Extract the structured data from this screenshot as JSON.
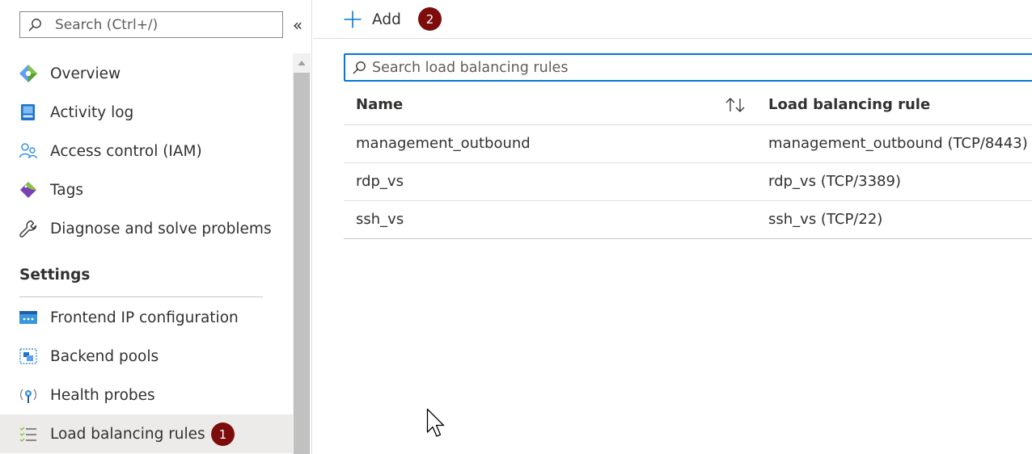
{
  "sidebar": {
    "search_placeholder": "Search (Ctrl+/)",
    "collapse_glyph": "«",
    "items": [
      {
        "label": "Overview",
        "icon": "overview-icon"
      },
      {
        "label": "Activity log",
        "icon": "activity-log-icon"
      },
      {
        "label": "Access control (IAM)",
        "icon": "access-control-icon"
      },
      {
        "label": "Tags",
        "icon": "tags-icon"
      },
      {
        "label": "Diagnose and solve problems",
        "icon": "wrench-icon"
      }
    ],
    "settings_title": "Settings",
    "settings_items": [
      {
        "label": "Frontend IP configuration",
        "icon": "frontend-ip-icon"
      },
      {
        "label": "Backend pools",
        "icon": "backend-pools-icon"
      },
      {
        "label": "Health probes",
        "icon": "health-probes-icon"
      },
      {
        "label": "Load balancing rules",
        "icon": "load-balancing-rules-icon",
        "active": true
      }
    ],
    "active_badge": "1"
  },
  "toolbar": {
    "add_label": "Add",
    "add_badge": "2"
  },
  "main": {
    "search_placeholder": "Search load balancing rules",
    "columns": [
      "Name",
      "Load balancing rule"
    ],
    "rows": [
      {
        "name": "management_outbound",
        "rule": "management_outbound (TCP/8443)"
      },
      {
        "name": "rdp_vs",
        "rule": "rdp_vs (TCP/3389)"
      },
      {
        "name": "ssh_vs",
        "rule": "ssh_vs (TCP/22)"
      }
    ]
  },
  "colors": {
    "accent": "#0078d4",
    "badge": "#7d0c0c",
    "active_bg": "#edebe9"
  }
}
